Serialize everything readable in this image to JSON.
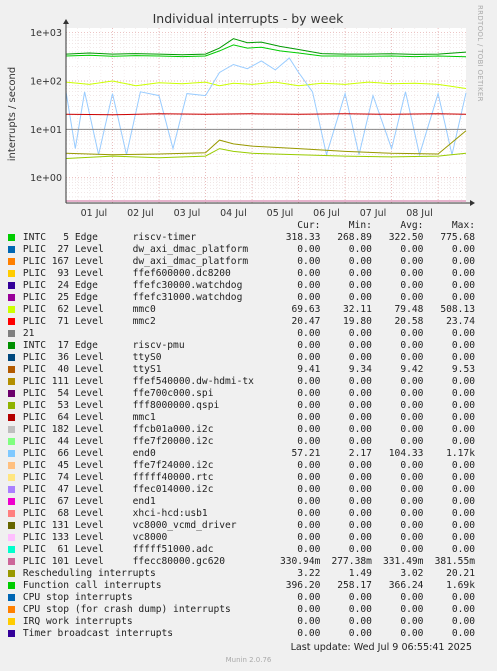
{
  "chart_data": {
    "type": "line",
    "title": "Individual interrupts - by week",
    "ylabel": "interrupts / second",
    "yscale": "log",
    "ylim": [
      0.3,
      1250
    ],
    "y_ticks": [
      {
        "value": 1,
        "label": "1e+00"
      },
      {
        "value": 10,
        "label": "1e+01"
      },
      {
        "value": 100,
        "label": "1e+02"
      },
      {
        "value": 1000,
        "label": "1e+03"
      }
    ],
    "x_ticks": [
      "01 Jul",
      "02 Jul",
      "03 Jul",
      "04 Jul",
      "05 Jul",
      "06 Jul",
      "07 Jul",
      "08 Jul"
    ],
    "xlim_days": [
      0,
      8.6
    ],
    "grid": true,
    "series": [
      {
        "name": "INTC 5 Edge riscv-timer",
        "color": "#00cc00",
        "points": [
          [
            0,
            330
          ],
          [
            0.5,
            340
          ],
          [
            1,
            325
          ],
          [
            1.5,
            335
          ],
          [
            2,
            330
          ],
          [
            2.5,
            320
          ],
          [
            3,
            330
          ],
          [
            3.3,
            420
          ],
          [
            3.6,
            560
          ],
          [
            3.9,
            480
          ],
          [
            4.2,
            500
          ],
          [
            4.6,
            420
          ],
          [
            5,
            380
          ],
          [
            5.5,
            330
          ],
          [
            6,
            330
          ],
          [
            6.5,
            325
          ],
          [
            7,
            330
          ],
          [
            7.5,
            320
          ],
          [
            8,
            330
          ],
          [
            8.6,
            318
          ]
        ]
      },
      {
        "name": "Function call interrupts",
        "color": "#009900",
        "points": [
          [
            0,
            360
          ],
          [
            0.5,
            380
          ],
          [
            1,
            360
          ],
          [
            1.5,
            370
          ],
          [
            2,
            360
          ],
          [
            2.5,
            350
          ],
          [
            3,
            360
          ],
          [
            3.3,
            480
          ],
          [
            3.6,
            750
          ],
          [
            3.9,
            620
          ],
          [
            4.2,
            640
          ],
          [
            4.6,
            520
          ],
          [
            5,
            450
          ],
          [
            5.5,
            370
          ],
          [
            6,
            360
          ],
          [
            6.5,
            360
          ],
          [
            7,
            365
          ],
          [
            7.5,
            355
          ],
          [
            8,
            360
          ],
          [
            8.6,
            396
          ]
        ]
      },
      {
        "name": "PLIC 62 Level mmc0",
        "color": "#ccff00",
        "points": [
          [
            0,
            95
          ],
          [
            0.5,
            85
          ],
          [
            1,
            100
          ],
          [
            1.5,
            80
          ],
          [
            2,
            92
          ],
          [
            2.5,
            88
          ],
          [
            3,
            95
          ],
          [
            3.3,
            80
          ],
          [
            3.6,
            90
          ],
          [
            4,
            85
          ],
          [
            4.5,
            95
          ],
          [
            5,
            80
          ],
          [
            5.5,
            90
          ],
          [
            6,
            85
          ],
          [
            6.5,
            95
          ],
          [
            7,
            88
          ],
          [
            7.5,
            90
          ],
          [
            8,
            85
          ],
          [
            8.6,
            70
          ]
        ]
      },
      {
        "name": "PLIC 66 Level end0",
        "color": "#99ccff",
        "points": [
          [
            0,
            60
          ],
          [
            0.2,
            4
          ],
          [
            0.4,
            60
          ],
          [
            0.7,
            3
          ],
          [
            1,
            55
          ],
          [
            1.3,
            3
          ],
          [
            1.6,
            60
          ],
          [
            2,
            50
          ],
          [
            2.3,
            4
          ],
          [
            2.6,
            55
          ],
          [
            3,
            50
          ],
          [
            3.3,
            150
          ],
          [
            3.6,
            220
          ],
          [
            3.9,
            180
          ],
          [
            4.2,
            260
          ],
          [
            4.5,
            170
          ],
          [
            4.8,
            300
          ],
          [
            5,
            150
          ],
          [
            5.3,
            60
          ],
          [
            5.6,
            3
          ],
          [
            6,
            55
          ],
          [
            6.3,
            3
          ],
          [
            6.6,
            50
          ],
          [
            7,
            4
          ],
          [
            7.3,
            60
          ],
          [
            7.6,
            3
          ],
          [
            8,
            55
          ],
          [
            8.3,
            3
          ],
          [
            8.6,
            57
          ]
        ]
      },
      {
        "name": "PLIC 71 Level mmc2",
        "color": "#cc0000",
        "points": [
          [
            0,
            20.5
          ],
          [
            1,
            20
          ],
          [
            2,
            21
          ],
          [
            3,
            20.5
          ],
          [
            4,
            21
          ],
          [
            5,
            20.5
          ],
          [
            6,
            21
          ],
          [
            7,
            20.5
          ],
          [
            8,
            21
          ],
          [
            8.6,
            20.5
          ]
        ]
      },
      {
        "name": "PLIC 40 Level ttyS1",
        "color": "#999900",
        "points": [
          [
            0,
            3.2
          ],
          [
            1,
            3
          ],
          [
            2,
            3.1
          ],
          [
            3,
            3.3
          ],
          [
            3.3,
            6
          ],
          [
            3.6,
            5
          ],
          [
            4,
            4.5
          ],
          [
            5,
            4
          ],
          [
            6,
            3.5
          ],
          [
            7,
            3.2
          ],
          [
            8,
            3.1
          ],
          [
            8.6,
            9.4
          ]
        ]
      },
      {
        "name": "Rescheduling interrupts",
        "color": "#99cc00",
        "points": [
          [
            0,
            2.5
          ],
          [
            1,
            2.8
          ],
          [
            2,
            2.6
          ],
          [
            3,
            2.8
          ],
          [
            3.3,
            4
          ],
          [
            3.6,
            3.5
          ],
          [
            4,
            3.2
          ],
          [
            5,
            3
          ],
          [
            6,
            2.8
          ],
          [
            7,
            2.7
          ],
          [
            8,
            2.8
          ],
          [
            8.6,
            3.2
          ]
        ]
      },
      {
        "name": "PLIC 101 Level ffecc80000.gc620",
        "color": "#cc6699",
        "points": [
          [
            0,
            0.33
          ],
          [
            2,
            0.33
          ],
          [
            4,
            0.33
          ],
          [
            6,
            0.33
          ],
          [
            8.6,
            0.33
          ]
        ]
      },
      {
        "name": "PLIC 111 Level",
        "color": "#888888",
        "points": [
          [
            0,
            10
          ],
          [
            4,
            10
          ],
          [
            8.6,
            10
          ]
        ]
      }
    ]
  },
  "legend": {
    "headers": {
      "cur": "Cur:",
      "min": "Min:",
      "avg": "Avg:",
      "max": "Max:"
    },
    "rows": [
      {
        "color": "#00cc00",
        "label": "INTC   5 Edge      riscv-timer",
        "cur": "318.33",
        "min": "268.89",
        "avg": "322.50",
        "max": "775.68"
      },
      {
        "color": "#0066b3",
        "label": "PLIC  27 Level     dw_axi_dmac_platform",
        "cur": "0.00",
        "min": "0.00",
        "avg": "0.00",
        "max": "0.00"
      },
      {
        "color": "#ff8000",
        "label": "PLIC 167 Level     dw_axi_dmac_platform",
        "cur": "0.00",
        "min": "0.00",
        "avg": "0.00",
        "max": "0.00"
      },
      {
        "color": "#ffcc00",
        "label": "PLIC  93 Level     ffef600000.dc8200",
        "cur": "0.00",
        "min": "0.00",
        "avg": "0.00",
        "max": "0.00"
      },
      {
        "color": "#330099",
        "label": "PLIC  24 Edge      ffefc30000.watchdog",
        "cur": "0.00",
        "min": "0.00",
        "avg": "0.00",
        "max": "0.00"
      },
      {
        "color": "#990099",
        "label": "PLIC  25 Edge      ffefc31000.watchdog",
        "cur": "0.00",
        "min": "0.00",
        "avg": "0.00",
        "max": "0.00"
      },
      {
        "color": "#ccff00",
        "label": "PLIC  62 Level     mmc0",
        "cur": "69.63",
        "min": "32.11",
        "avg": "79.48",
        "max": "508.13"
      },
      {
        "color": "#ff0000",
        "label": "PLIC  71 Level     mmc2",
        "cur": "20.47",
        "min": "19.80",
        "avg": "20.58",
        "max": "23.74"
      },
      {
        "color": "#808080",
        "label": "21",
        "cur": "0.00",
        "min": "0.00",
        "avg": "0.00",
        "max": "0.00"
      },
      {
        "color": "#008f00",
        "label": "INTC  17 Edge      riscv-pmu",
        "cur": "0.00",
        "min": "0.00",
        "avg": "0.00",
        "max": "0.00"
      },
      {
        "color": "#00487d",
        "label": "PLIC  36 Level     ttyS0",
        "cur": "0.00",
        "min": "0.00",
        "avg": "0.00",
        "max": "0.00"
      },
      {
        "color": "#b35a00",
        "label": "PLIC  40 Level     ttyS1",
        "cur": "9.41",
        "min": "9.34",
        "avg": "9.42",
        "max": "9.53"
      },
      {
        "color": "#b38f00",
        "label": "PLIC 111 Level     ffef540000.dw-hdmi-tx",
        "cur": "0.00",
        "min": "0.00",
        "avg": "0.00",
        "max": "0.00"
      },
      {
        "color": "#6b006b",
        "label": "PLIC  54 Level     ffe700c000.spi",
        "cur": "0.00",
        "min": "0.00",
        "avg": "0.00",
        "max": "0.00"
      },
      {
        "color": "#8fb300",
        "label": "PLIC  53 Level     fff8000000.qspi",
        "cur": "0.00",
        "min": "0.00",
        "avg": "0.00",
        "max": "0.00"
      },
      {
        "color": "#b30000",
        "label": "PLIC  64 Level     mmc1",
        "cur": "0.00",
        "min": "0.00",
        "avg": "0.00",
        "max": "0.00"
      },
      {
        "color": "#bebebe",
        "label": "PLIC 182 Level     ffcb01a000.i2c",
        "cur": "0.00",
        "min": "0.00",
        "avg": "0.00",
        "max": "0.00"
      },
      {
        "color": "#80ff80",
        "label": "PLIC  44 Level     ffe7f20000.i2c",
        "cur": "0.00",
        "min": "0.00",
        "avg": "0.00",
        "max": "0.00"
      },
      {
        "color": "#80c9ff",
        "label": "PLIC  66 Level     end0",
        "cur": "57.21",
        "min": "2.17",
        "avg": "104.33",
        "max": "1.17k"
      },
      {
        "color": "#ffc080",
        "label": "PLIC  45 Level     ffe7f24000.i2c",
        "cur": "0.00",
        "min": "0.00",
        "avg": "0.00",
        "max": "0.00"
      },
      {
        "color": "#ffe680",
        "label": "PLIC  74 Level     fffff40000.rtc",
        "cur": "0.00",
        "min": "0.00",
        "avg": "0.00",
        "max": "0.00"
      },
      {
        "color": "#aa80ff",
        "label": "PLIC  47 Level     ffec014000.i2c",
        "cur": "0.00",
        "min": "0.00",
        "avg": "0.00",
        "max": "0.00"
      },
      {
        "color": "#ee00cc",
        "label": "PLIC  67 Level     end1",
        "cur": "0.00",
        "min": "0.00",
        "avg": "0.00",
        "max": "0.00"
      },
      {
        "color": "#ff8080",
        "label": "PLIC  68 Level     xhci-hcd:usb1",
        "cur": "0.00",
        "min": "0.00",
        "avg": "0.00",
        "max": "0.00"
      },
      {
        "color": "#666600",
        "label": "PLIC 131 Level     vc8000_vcmd_driver",
        "cur": "0.00",
        "min": "0.00",
        "avg": "0.00",
        "max": "0.00"
      },
      {
        "color": "#ffbfff",
        "label": "PLIC 133 Level     vc8000",
        "cur": "0.00",
        "min": "0.00",
        "avg": "0.00",
        "max": "0.00"
      },
      {
        "color": "#00ffcc",
        "label": "PLIC  61 Level     fffff51000.adc",
        "cur": "0.00",
        "min": "0.00",
        "avg": "0.00",
        "max": "0.00"
      },
      {
        "color": "#cc6699",
        "label": "PLIC 101 Level     ffecc80000.gc620",
        "cur": "330.94m",
        "min": "277.38m",
        "avg": "331.49m",
        "max": "381.55m"
      },
      {
        "color": "#999900",
        "label": "Rescheduling interrupts",
        "cur": "3.22",
        "min": "1.49",
        "avg": "3.02",
        "max": "20.21"
      },
      {
        "color": "#00cc00",
        "label": "Function call interrupts",
        "cur": "396.20",
        "min": "258.17",
        "avg": "366.24",
        "max": "1.69k"
      },
      {
        "color": "#0066b3",
        "label": "CPU stop interrupts",
        "cur": "0.00",
        "min": "0.00",
        "avg": "0.00",
        "max": "0.00"
      },
      {
        "color": "#ff8000",
        "label": "CPU stop (for crash dump) interrupts",
        "cur": "0.00",
        "min": "0.00",
        "avg": "0.00",
        "max": "0.00"
      },
      {
        "color": "#ffcc00",
        "label": "IRQ work interrupts",
        "cur": "0.00",
        "min": "0.00",
        "avg": "0.00",
        "max": "0.00"
      },
      {
        "color": "#330099",
        "label": "Timer broadcast interrupts",
        "cur": "0.00",
        "min": "0.00",
        "avg": "0.00",
        "max": "0.00"
      }
    ]
  },
  "footer": {
    "last_update": "Last update: Wed Jul  9 06:55:41 2025",
    "munin": "Munin 2.0.76"
  },
  "watermark": "RRDTOOL / TOBI OETIKER"
}
